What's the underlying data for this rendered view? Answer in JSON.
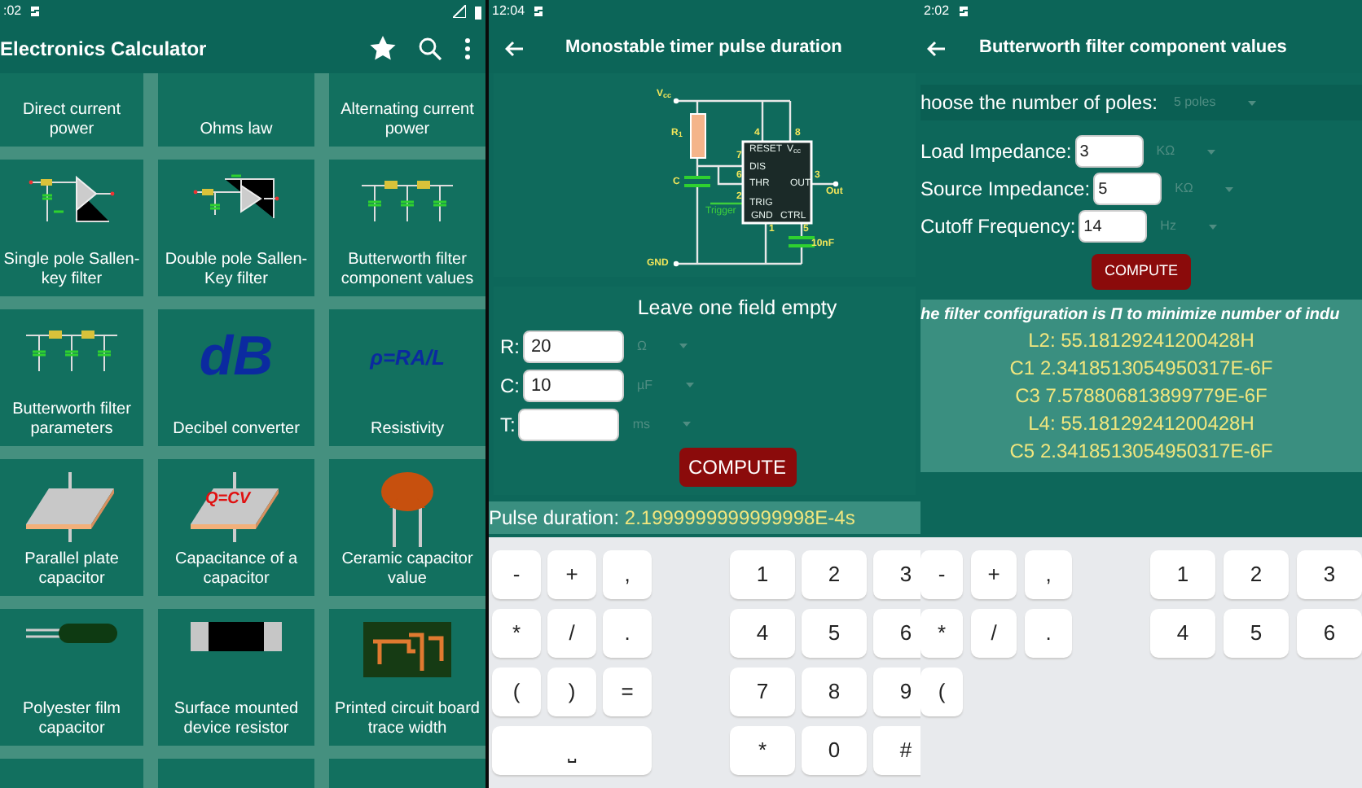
{
  "home_screen": {
    "status_time": ":02",
    "title": "Electronics Calculator",
    "tiles": [
      {
        "kind": "none",
        "label": "Direct current power"
      },
      {
        "kind": "none",
        "label": "Ohms law"
      },
      {
        "kind": "none",
        "label": "Alternating current power"
      },
      {
        "kind": "sallen-single",
        "label": "Single pole Sallen-key filter"
      },
      {
        "kind": "sallen-double",
        "label": "Double pole Sallen-Key filter"
      },
      {
        "kind": "ladder",
        "label": "Butterworth filter component values"
      },
      {
        "kind": "ladder",
        "label": "Butterworth filter parameters"
      },
      {
        "kind": "decibel",
        "icon_text": "dB",
        "label": "Decibel converter"
      },
      {
        "kind": "formula",
        "icon_text": "ρ=RA/L",
        "label": "Resistivity"
      },
      {
        "kind": "plate",
        "label": "Parallel plate capacitor"
      },
      {
        "kind": "plate-formula",
        "icon_text": "Q=CV",
        "label": "Capacitance of a capacitor"
      },
      {
        "kind": "ceramic",
        "label": "Ceramic capacitor value"
      },
      {
        "kind": "film",
        "label": "Polyester film capacitor"
      },
      {
        "kind": "smd",
        "label": "Surface mounted device resistor"
      },
      {
        "kind": "pcb",
        "label": "Printed circuit board trace width"
      },
      {
        "kind": "empty"
      },
      {
        "kind": "empty"
      },
      {
        "kind": "empty"
      }
    ]
  },
  "timer_screen": {
    "status_time": "12:04",
    "title": "Monostable timer pulse duration",
    "circuit": {
      "labels": [
        {
          "text": "V$_{cc}$",
          "kind": "part"
        },
        {
          "text": "R$_{1}$",
          "kind": "part"
        },
        {
          "text": "C",
          "kind": "part"
        },
        {
          "text": "4",
          "kind": "part"
        },
        {
          "text": "8",
          "kind": "part"
        },
        {
          "text": "RESET",
          "kind": "chip"
        },
        {
          "text": "V$_{cc}$",
          "kind": "chip"
        },
        {
          "text": "7",
          "kind": "part"
        },
        {
          "text": "DIS",
          "kind": "chip"
        },
        {
          "text": "6",
          "kind": "part"
        },
        {
          "text": "THR",
          "kind": "chip"
        },
        {
          "text": "OUT",
          "kind": "chip"
        },
        {
          "text": "3",
          "kind": "part"
        },
        {
          "text": "Out",
          "kind": "part"
        },
        {
          "text": "2",
          "kind": "part"
        },
        {
          "text": "TRIG",
          "kind": "chip"
        },
        {
          "text": "Trigger",
          "kind": "signal"
        },
        {
          "text": "GND",
          "kind": "chip"
        },
        {
          "text": "CTRL",
          "kind": "chip"
        },
        {
          "text": "1",
          "kind": "part"
        },
        {
          "text": "5",
          "kind": "part"
        },
        {
          "text": "10nF",
          "kind": "part"
        },
        {
          "text": "GND",
          "kind": "part"
        }
      ]
    },
    "form": {
      "heading": "Leave one field empty",
      "fields": [
        {
          "label": "R:",
          "value": "20",
          "unit": "Ω"
        },
        {
          "label": "C:",
          "value": "10",
          "unit": "µF"
        },
        {
          "label": "T:",
          "unit": "ms"
        }
      ],
      "button": "COMPUTE"
    },
    "result": {
      "label": "Pulse duration: ",
      "value": "2.1999999999999998E-4s"
    },
    "keyboard": {
      "rows": [
        {
          "symbols": [
            {
              "label": "-",
              "kind": "key"
            },
            {
              "label": "+",
              "kind": "key"
            },
            {
              "label": ",",
              "kind": "key"
            }
          ],
          "digits": [
            "1",
            "2",
            "3"
          ]
        },
        {
          "symbols": [
            {
              "label": "*",
              "kind": "key"
            },
            {
              "label": "/",
              "kind": "key"
            },
            {
              "label": ".",
              "kind": "key"
            }
          ],
          "digits": [
            "4",
            "5",
            "6"
          ]
        },
        {
          "symbols": [
            {
              "label": "(",
              "kind": "key"
            },
            {
              "label": ")",
              "kind": "key"
            },
            {
              "label": "=",
              "kind": "key"
            }
          ],
          "digits": [
            "7",
            "8",
            "9"
          ]
        },
        {
          "symbols": [
            {
              "label": "⎵",
              "kind": "space"
            }
          ],
          "digits": [
            "*",
            "0",
            "#"
          ]
        }
      ]
    }
  },
  "filter_screen": {
    "status_time": "2:02",
    "title": "Butterworth filter component values",
    "poles": {
      "label": "hoose the number of poles:",
      "value": "5 poles"
    },
    "fields": [
      {
        "label": "Load Impedance:",
        "value": "3",
        "unit": "KΩ"
      },
      {
        "label": "Source Impedance:",
        "value": "5",
        "unit": "KΩ"
      },
      {
        "label": "Cutoff Frequency:",
        "value": "14",
        "unit": "Hz"
      }
    ],
    "button": "COMPUTE",
    "result": {
      "note": "he filter configuration is Π to minimize number of indu",
      "lines": [
        "L2: 55.18129241200428H",
        "C1 2.3418513054950317E-6F",
        "C3 7.578806813899779E-6F",
        "L4: 55.18129241200428H",
        "C5 2.3418513054950317E-6F"
      ]
    },
    "keyboard": {
      "rows": [
        {
          "symbols": [
            {
              "label": "-",
              "kind": "key"
            },
            {
              "label": "+",
              "kind": "key"
            },
            {
              "label": ",",
              "kind": "key"
            }
          ],
          "digits": [
            "1",
            "2",
            "3"
          ]
        },
        {
          "symbols": [
            {
              "label": "*",
              "kind": "key"
            },
            {
              "label": "/",
              "kind": "key"
            },
            {
              "label": ".",
              "kind": "key"
            }
          ],
          "digits": [
            "4",
            "5",
            "6"
          ]
        },
        {
          "symbols": [
            {
              "label": "(",
              "kind": "key"
            }
          ],
          "digits": []
        }
      ]
    }
  }
}
